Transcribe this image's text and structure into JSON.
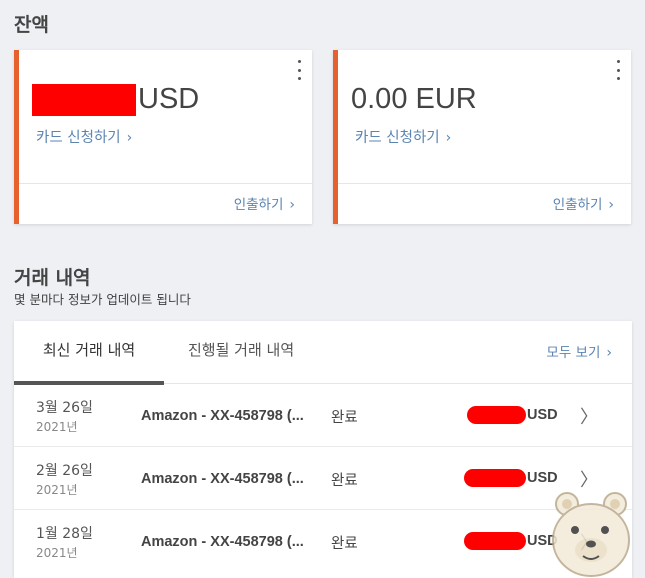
{
  "balance": {
    "title": "잔액",
    "cards": [
      {
        "currency": "USD",
        "amount": "",
        "link": "카드 신청하기",
        "withdraw": "인출하기"
      },
      {
        "currency": "EUR",
        "amount": "0.00",
        "link": "카드 신청하기",
        "withdraw": "인출하기"
      }
    ]
  },
  "transactions": {
    "title": "거래 내역",
    "subtitle": "몇 분마다 정보가 업데이트 됩니다",
    "tabs": [
      "최신 거래 내역",
      "진행될 거래 내역"
    ],
    "view_all": "모두 보기",
    "rows": [
      {
        "date": "3월 26일",
        "year": "2021년",
        "desc": "Amazon - XX-458798 (...",
        "status": "완료",
        "currency": "USD"
      },
      {
        "date": "2월 26일",
        "year": "2021년",
        "desc": "Amazon - XX-458798 (...",
        "status": "완료",
        "currency": "USD"
      },
      {
        "date": "1월 28일",
        "year": "2021년",
        "desc": "Amazon - XX-458798 (...",
        "status": "완료",
        "currency": "USD"
      }
    ]
  },
  "colors": {
    "accent": "#e5612d",
    "link": "#5b84b1",
    "redaction": "#ff0000"
  },
  "icons": {
    "menu": "more-vert-icon",
    "chevron": "chevron-right-icon",
    "mascot": "bear-mascot-icon"
  }
}
